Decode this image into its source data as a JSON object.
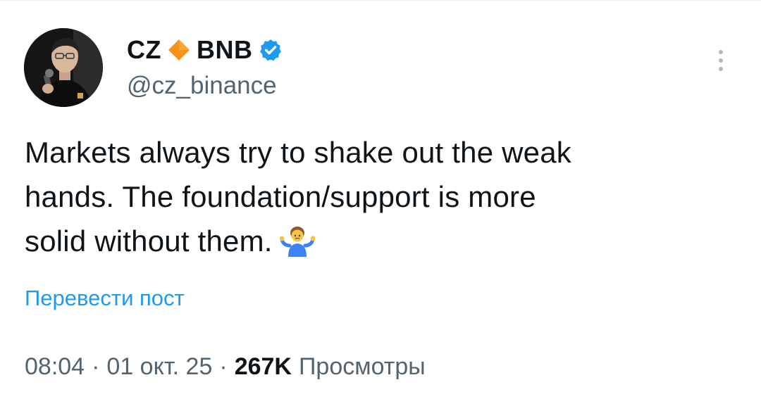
{
  "author": {
    "name": "CZ",
    "org": "BNB",
    "handle": "@cz_binance",
    "diamond_color": "#f7931a",
    "verified_color": "#1d9bf0"
  },
  "tweet": {
    "lines": [
      "Markets always try to shake out the weak",
      "hands. The foundation/support is more",
      "solid without them."
    ],
    "emoji": "shrug-icon"
  },
  "translate_label": "Перевести пост",
  "meta": {
    "time": "08:04",
    "date": "01 окт. 25",
    "separator": "·",
    "views_count": "267K",
    "views_label": "Просмотры"
  },
  "colors": {
    "text": "#0f1419",
    "secondary": "#536471",
    "link": "#1d9bf0"
  }
}
